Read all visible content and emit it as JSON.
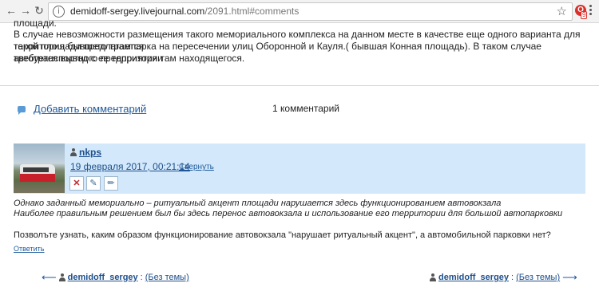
{
  "browser": {
    "host": "demidoff-sergey.livejournal.com",
    "path": "/2091.html#comments",
    "extension_count": "9"
  },
  "post": {
    "line0": "площади.",
    "line1": "В случае невозможности размещения такого мемориального комплекса на данном месте в качестве еще одного варианта для такой площади предлагается",
    "line2": "территория бывшего трампарка на пересечении улиц Оборонной и Кауля.( бывшая Конная площадь). В таком случае требуется вывод с ее территории",
    "line3": "автотранспортного предприятия там находящегося."
  },
  "comments_bar": {
    "add_label": "Добавить комментарий",
    "count_label": "1 комментарий"
  },
  "comment": {
    "username": "nkps",
    "date": "19 февраля 2017, 00:21:14",
    "collapse_label": "Свернуть",
    "text_line1": "Однако заданный мемориально – ритуальный акцент площади нарушается здесь функционированием автовокзала",
    "text_line2": "Наиболее правильным решением был бы здесь перенос автовокзала и использование его территории для большой автопарковки",
    "question": "Позволъте узнать, каким образом функционирование автовокзала \"нарушает ритуальный акцент\", а автомобильной парковки нет?",
    "reply_label": "Ответить"
  },
  "nav": {
    "prev_user": "demidoff_sergey",
    "prev_sep": ":",
    "prev_subject": "(Без темы)",
    "next_user": "demidoff_sergey",
    "next_sep": ":",
    "next_subject": "(Без темы)"
  },
  "colors": {
    "link": "#1f4f8c",
    "comment_bg": "#d3e9fb",
    "divider": "#b7d8ee"
  }
}
